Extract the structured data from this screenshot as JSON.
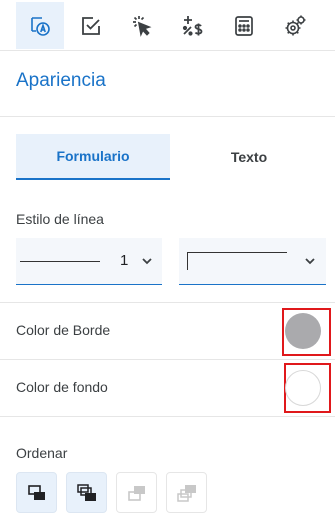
{
  "toolbar": {
    "tabs": [
      {
        "icon": "appearance-icon",
        "active": true
      },
      {
        "icon": "checkbox-icon",
        "active": false
      },
      {
        "icon": "click-icon",
        "active": false
      },
      {
        "icon": "currency-math-icon",
        "active": false
      },
      {
        "icon": "calculator-icon",
        "active": false
      },
      {
        "icon": "gear-icon",
        "active": false
      }
    ]
  },
  "panel": {
    "title": "Apariencia",
    "tabs": [
      {
        "label": "Formulario",
        "active": true
      },
      {
        "label": "Texto",
        "active": false
      }
    ],
    "line_style": {
      "label": "Estilo de línea",
      "width_value": "1"
    },
    "border_color": {
      "label": "Color de Borde",
      "value": "#aaaaad"
    },
    "fill_color": {
      "label": "Color de fondo",
      "value": "#ffffff"
    },
    "order": {
      "label": "Ordenar"
    }
  },
  "colors": {
    "accent": "#1a73c8",
    "highlight": "#e0181b"
  }
}
